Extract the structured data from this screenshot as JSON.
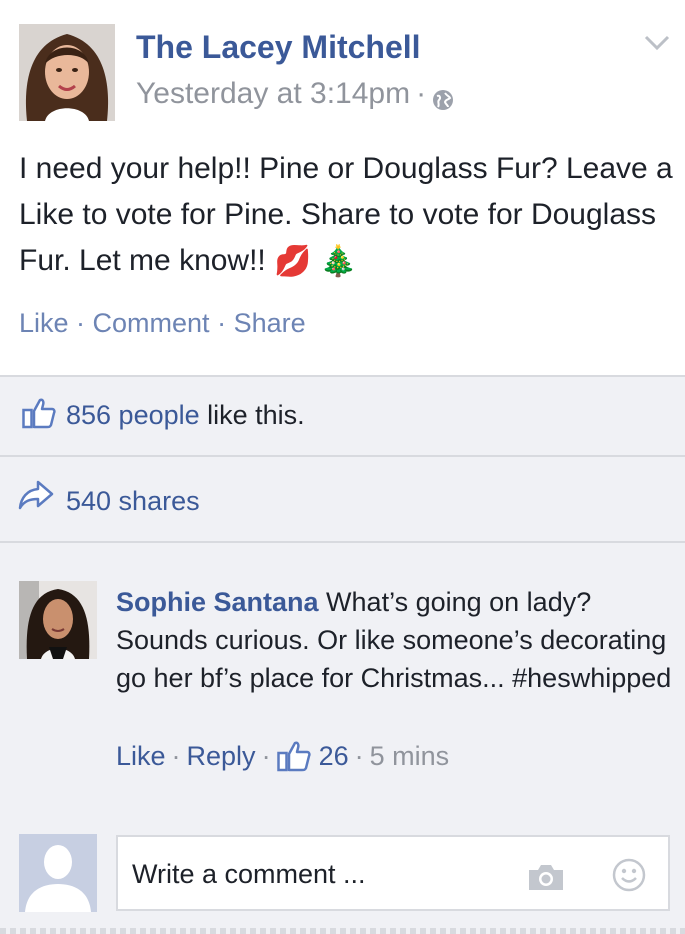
{
  "post": {
    "author": "The Lacey Mitchell",
    "timestamp": "Yesterday at 3:14pm",
    "meta_dot": "·",
    "text": "I need your help!! Pine or Douglass Fur? Leave a Like to vote for Pine. Share to vote for Douglass Fur. Let me know!!",
    "emoji_lips": "💋",
    "emoji_tree": "🎄",
    "actions": {
      "like": "Like",
      "comment": "Comment",
      "share": "Share",
      "sep": " · "
    },
    "menu_icon": "chevron-down-icon",
    "privacy_icon": "globe-icon"
  },
  "likes": {
    "count_link": "856 people",
    "suffix": " like this."
  },
  "shares": {
    "label": "540 shares"
  },
  "comment": {
    "name": "Sophie Santana",
    "text": " What’s going on lady? Sounds curious. Or like someone’s decorating go her bf’s place for Christmas... #heswhipped",
    "like": "Like",
    "reply": "Reply",
    "like_count": "26",
    "time": "5 mins",
    "sep": "·"
  },
  "composer": {
    "placeholder": "Write a comment ...",
    "camera_icon": "camera-icon",
    "emoji_icon": "smiley-icon"
  },
  "colors": {
    "link": "#3b5998",
    "muted": "#90949c",
    "action": "#6d84b4",
    "background": "#f0f1f5"
  }
}
